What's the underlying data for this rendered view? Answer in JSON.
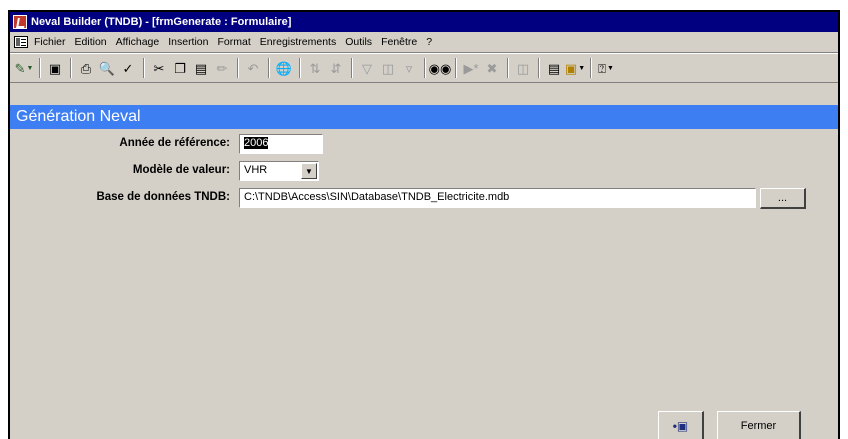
{
  "window": {
    "title": "Neval Builder (TNDB) - [frmGenerate : Formulaire]"
  },
  "menu": {
    "items": [
      "Fichier",
      "Edition",
      "Affichage",
      "Insertion",
      "Format",
      "Enregistrements",
      "Outils",
      "Fenêtre",
      "?"
    ]
  },
  "toolbar": {
    "icons": [
      "design-view-icon",
      "save-icon",
      "print-icon",
      "print-preview-icon",
      "spelling-icon",
      "cut-icon",
      "copy-icon",
      "paste-icon",
      "format-painter-icon",
      "undo-icon",
      "hyperlink-icon",
      "sort-ascending-icon",
      "sort-descending-icon",
      "filter-by-selection-icon",
      "filter-by-form-icon",
      "apply-filter-icon",
      "find-icon",
      "new-record-icon",
      "delete-record-icon",
      "properties-icon",
      "database-window-icon",
      "new-object-icon",
      "help-icon"
    ]
  },
  "form": {
    "header": "Génération Neval",
    "annee_label": "Année de référence:",
    "annee_value": "2006",
    "modele_label": "Modèle de valeur:",
    "modele_value": "VHR",
    "base_label": "Base de données TNDB:",
    "base_value": "C:\\TNDB\\Access\\SIN\\Database\\TNDB_Electricite.mdb",
    "browse_label": "...",
    "fermer_label": "Fermer"
  },
  "colors": {
    "title_bar": "#000080",
    "form_header": "#3d7ef2",
    "window_bg": "#d4d0c8"
  }
}
